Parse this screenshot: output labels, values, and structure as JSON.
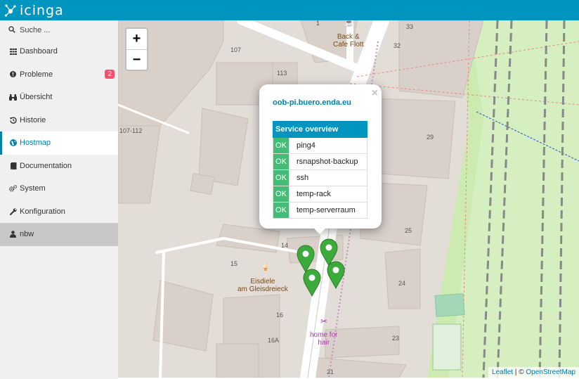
{
  "app": {
    "logo_text": "icinga"
  },
  "search": {
    "label": "Suche ...",
    "icon": "search-icon"
  },
  "nav": [
    {
      "label": "Dashboard",
      "icon": "dashboard-icon"
    },
    {
      "label": "Probleme",
      "icon": "exclamation-icon",
      "badge": "2"
    },
    {
      "label": "Übersicht",
      "icon": "binoculars-icon"
    },
    {
      "label": "Historie",
      "icon": "history-icon"
    },
    {
      "label": "Hostmap",
      "icon": "globe-icon",
      "active": true
    },
    {
      "label": "Documentation",
      "icon": "book-icon"
    },
    {
      "label": "System",
      "icon": "cogs-icon"
    },
    {
      "label": "Konfiguration",
      "icon": "wrench-icon"
    },
    {
      "label": "nbw",
      "icon": "user-icon"
    }
  ],
  "map": {
    "zoom_in": "+",
    "zoom_out": "−",
    "labels": {
      "n107": "107",
      "n113": "113",
      "n107_112": "107-112",
      "n33": "33",
      "n32": "32",
      "n29": "29",
      "n25": "25",
      "n24": "24",
      "n23": "23",
      "n21": "21",
      "n14": "14",
      "n15": "15",
      "n16": "16",
      "n16a": "16A",
      "n1": "1"
    },
    "pois": {
      "cafe": "Back &\nCafe Flott",
      "eisdiele": "Eisdiele\nam Gleisdreieck",
      "hair": "home for\nhair"
    },
    "attribution": {
      "leaflet": "Leaflet",
      "sep": " | © ",
      "osm": "OpenStreetMap"
    }
  },
  "popup": {
    "close": "×",
    "host": "oob-pi.buero.enda.eu",
    "table_header": "Service overview",
    "services": [
      {
        "state": "OK",
        "name": "ping4"
      },
      {
        "state": "OK",
        "name": "rsnapshot-backup"
      },
      {
        "state": "OK",
        "name": "ssh"
      },
      {
        "state": "OK",
        "name": "temp-rack"
      },
      {
        "state": "OK",
        "name": "temp-serverraum"
      }
    ]
  },
  "colors": {
    "header": "#0095bf",
    "ok": "#44bb77",
    "badge": "#f0536b",
    "active": "#0081a8"
  }
}
